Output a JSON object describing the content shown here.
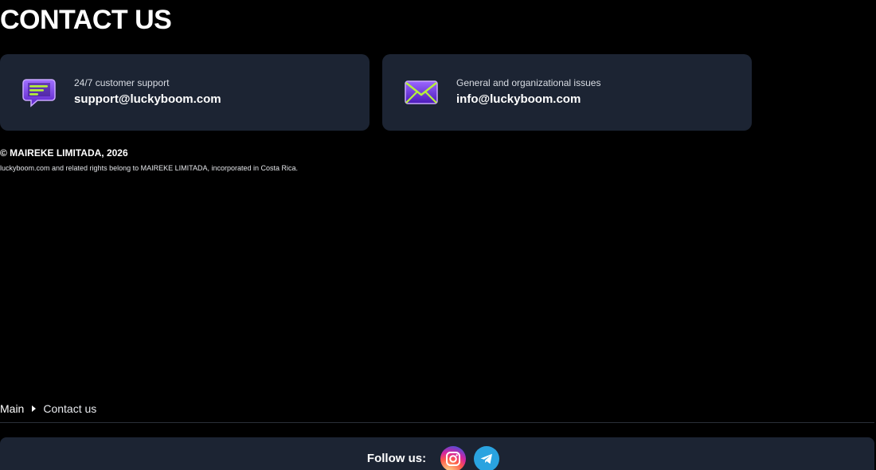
{
  "page": {
    "title": "CONTACT US"
  },
  "contacts": [
    {
      "caption": "24/7 customer support",
      "email": "support@luckyboom.com",
      "icon": "chat-bubble-icon"
    },
    {
      "caption": "General and organizational issues",
      "email": "info@luckyboom.com",
      "icon": "envelope-icon"
    }
  ],
  "legal": {
    "copyright": "© MAIREKE LIMITADA, 2026",
    "rights": "luckyboom.com and related rights belong to MAIREKE LIMITADA, incorporated in Costa Rica."
  },
  "breadcrumb": {
    "home": "Main",
    "current": "Contact us"
  },
  "footer": {
    "follow_label": "Follow us:",
    "socials": [
      "instagram-icon",
      "telegram-icon"
    ]
  },
  "colors": {
    "background": "#000000",
    "card": "#1c2433",
    "icon_purple": "#7b3fe4",
    "icon_green": "#b6f23a",
    "telegram": "#2aa3e0"
  }
}
